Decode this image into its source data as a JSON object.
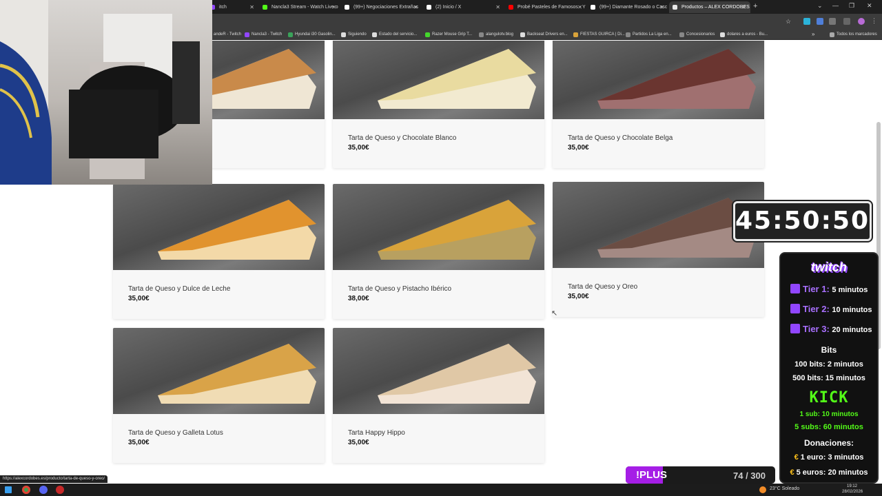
{
  "browser": {
    "tabs": [
      {
        "title": "itch",
        "favicon_color": "#9146ff"
      },
      {
        "title": "Nancla3 Stream - Watch Live o",
        "favicon_color": "#53fc18"
      },
      {
        "title": "(99+) Negociaciones Extrañas",
        "favicon_color": "#ffffff"
      },
      {
        "title": "(2) Inicio / X",
        "favicon_color": "#ffffff"
      },
      {
        "title": "Probé Pasteles de Famosos - Y",
        "favicon_color": "#ff0000"
      },
      {
        "title": "(99+) Diamante Rosado o Casc",
        "favicon_color": "#ffffff"
      },
      {
        "title": "Productos – ALEX CORDOBES",
        "favicon_color": "#e8e8e8",
        "active": true
      }
    ],
    "new_tab": "+",
    "window_controls": [
      "⌄",
      "—",
      "❐",
      "✕"
    ],
    "bookmarks": [
      "andeR - Twitch",
      "Nancla3 - Twitch",
      "Hyundai i30 Gasolin...",
      "Siguiendo",
      "Estado del servicio...",
      "Razer Mouse Grip T...",
      "alangulotv.blog",
      "Backseat Drivers en...",
      "FIESTAS GUIRCA | Di...",
      "Partidos La Liga en...",
      "Concesionarios",
      "dolares a euros - Bu..."
    ],
    "bookmarks_more": "»",
    "all_bookmarks": "Todos los marcadores",
    "status_url": "https://alexcordobes.es/producto/tarta-de-queso-y-oreo/"
  },
  "products": [
    {
      "name": "",
      "price": "",
      "slice_top": "#c98a4a",
      "slice_body": "#efe6d4"
    },
    {
      "name": "Tarta de Queso y Chocolate Blanco",
      "price": "35,00€",
      "slice_top": "#e9dba0",
      "slice_body": "#f2ead0"
    },
    {
      "name": "Tarta de Queso y Chocolate Belga",
      "price": "35,00€",
      "slice_top": "#6a3530",
      "slice_body": "#a07070"
    },
    {
      "name": "Tarta de Queso y Dulce de Leche",
      "price": "35,00€",
      "slice_top": "#e1932e",
      "slice_body": "#f3d9a8"
    },
    {
      "name": "Tarta de Queso y Pistacho Ibérico",
      "price": "38,00€",
      "slice_top": "#d9a33a",
      "slice_body": "#b8a060"
    },
    {
      "name": "Tarta de Queso y Oreo",
      "price": "35,00€",
      "slice_top": "#6b4d43",
      "slice_body": "#a48a84"
    },
    {
      "name": "Tarta de Queso y Galleta Lotus",
      "price": "35,00€",
      "slice_top": "#d9a348",
      "slice_body": "#f0dcb4"
    },
    {
      "name": "Tarta Happy Hippo",
      "price": "35,00€",
      "slice_top": "#e0c8a6",
      "slice_body": "#f2e4d6"
    }
  ],
  "overlay": {
    "timer": "45:50:50",
    "twitch_label": "twitch",
    "tiers": [
      {
        "name": "Tier 1:",
        "value": "5 minutos"
      },
      {
        "name": "Tier 2:",
        "value": "10 minutos"
      },
      {
        "name": "Tier 3:",
        "value": "20 minutos"
      }
    ],
    "bits_title": "Bits",
    "bits": [
      "100 bits: 2 minutos",
      "500 bits: 15 minutos"
    ],
    "kick_label": "KICK",
    "kick_subs": [
      "1 sub: 10 minutos",
      "5 subs: 60 minutos"
    ],
    "donations_title": "Donaciones:",
    "donations": [
      "1 euro: 3 minutos",
      "5 euros: 20 minutos"
    ],
    "euro_symbol": "€",
    "plus_label": "!PLUS",
    "plus_count": "74 / 300",
    "plus_progress": 0.25
  },
  "taskbar": {
    "weather": "23°C  Soleado",
    "time": "19:12",
    "date": "28/02/2026"
  },
  "colors": {
    "twitch_purple": "#9146ff",
    "kick_green": "#53fc18",
    "plus_purple": "#a51ee6"
  }
}
